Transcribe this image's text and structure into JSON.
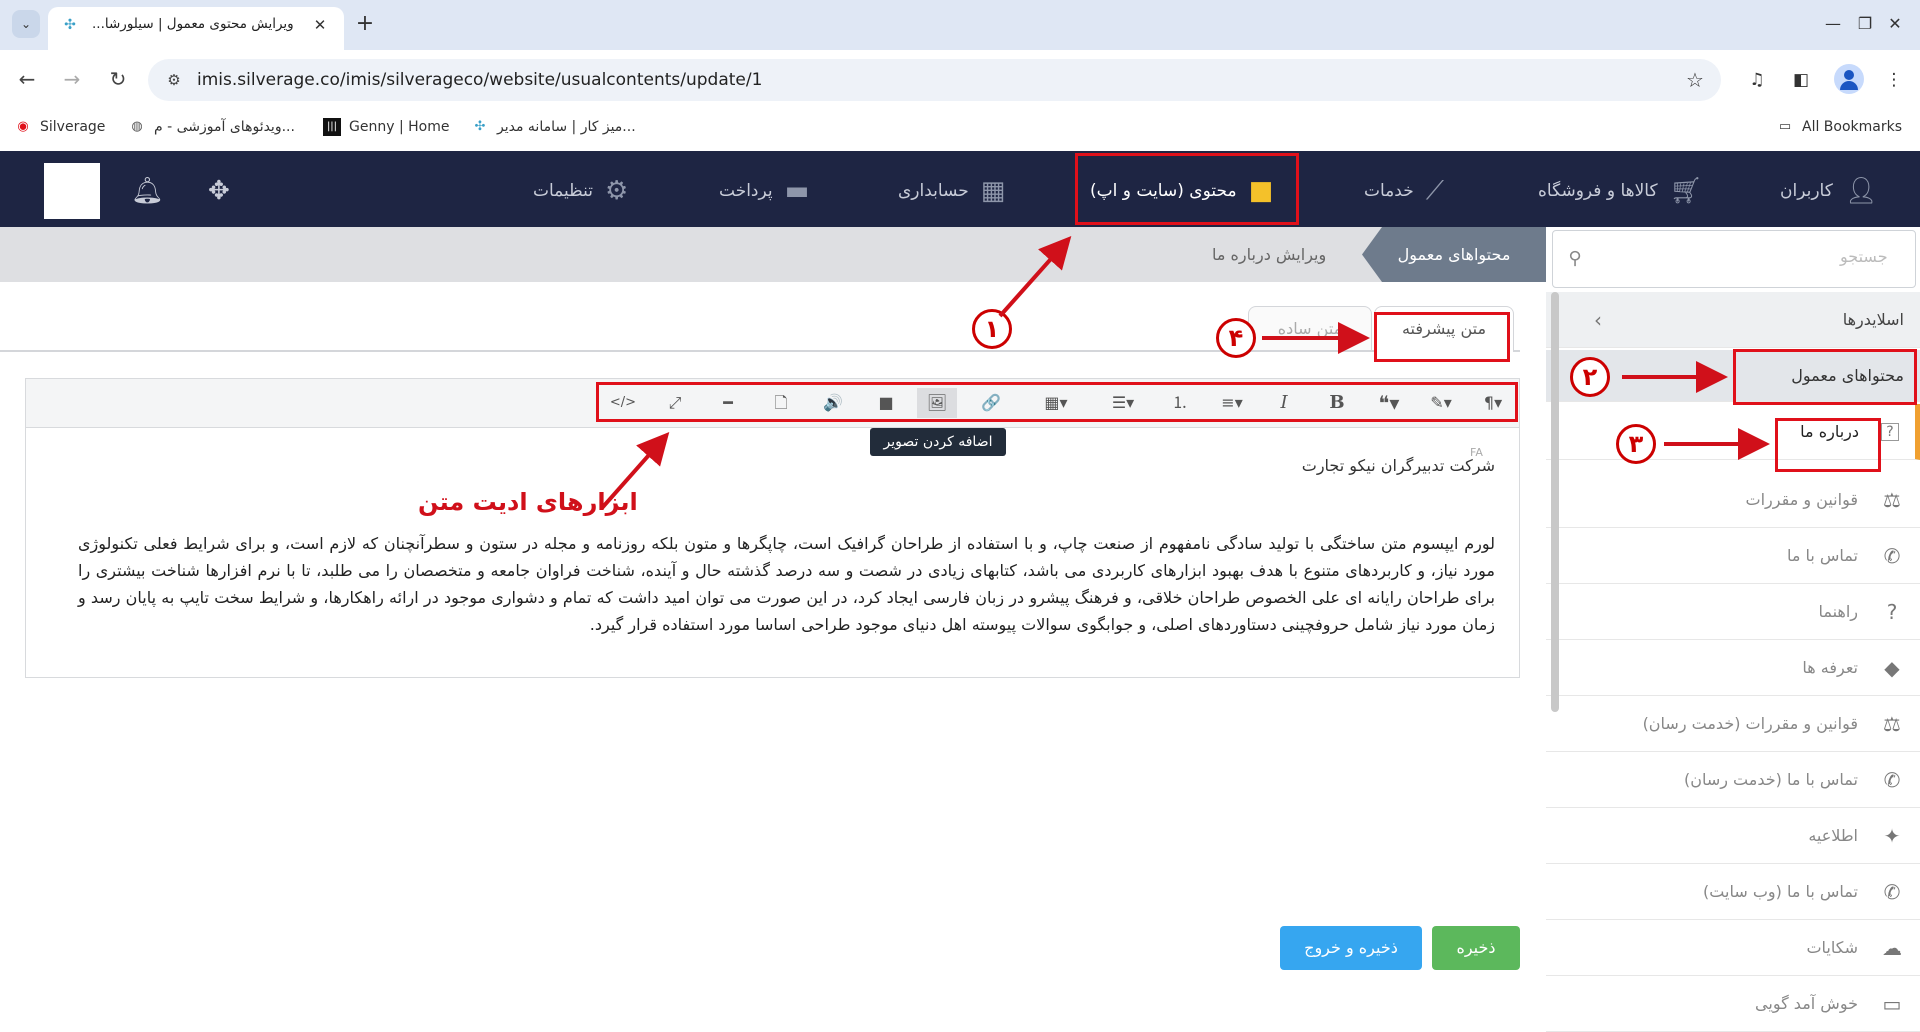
{
  "browser": {
    "tab_title": "ویرایش محتوی معمول | سیلورشا...",
    "url": "imis.silverage.co/imis/silverageco/website/usualcontents/update/1",
    "new_tab_symbol": "+",
    "close_symbol": "✕",
    "window_controls": [
      "—",
      "❐",
      "✕"
    ],
    "bookmarks": [
      {
        "label": "Silverage",
        "icon": "silverage-logo-icon"
      },
      {
        "label": "ویدئوهای آموزشی - م...",
        "icon": "globe-icon"
      },
      {
        "label": "Genny | Home",
        "icon": "genny-logo-icon"
      },
      {
        "label": "میز کار | سامانه مدیر...",
        "icon": "imis-logo-icon"
      }
    ],
    "all_bookmarks": "All Bookmarks"
  },
  "topnav": {
    "items": [
      {
        "label": "کاربران",
        "icon": "user-icon"
      },
      {
        "label": "کالاها و فروشگاه",
        "icon": "cart-icon"
      },
      {
        "label": "خدمات",
        "icon": "broom-icon"
      },
      {
        "label": "محتوی (سایت و اپ)",
        "icon": "folder-icon"
      },
      {
        "label": "حسابداری",
        "icon": "calculator-icon"
      },
      {
        "label": "پرداخت",
        "icon": "card-icon"
      },
      {
        "label": "تنظیمات",
        "icon": "gear-icon"
      }
    ],
    "highlight_color": "#e0101a",
    "bar_color": "#1e2543"
  },
  "breadcrumb": {
    "current_section": "محتواهای معمول",
    "page": "ویرایش درباره ما"
  },
  "search": {
    "placeholder": "جستجو"
  },
  "sidebar": {
    "items": [
      {
        "label": "اسلایدرها",
        "icon": "chevron-left-icon"
      },
      {
        "label": "محتواهای معمول",
        "icon": "chevron-down-icon"
      },
      {
        "label": "درباره ما",
        "icon": "question-icon"
      },
      {
        "label": "قوانین و مقررات",
        "icon": "scale-icon"
      },
      {
        "label": "تماس با ما",
        "icon": "phone-icon"
      },
      {
        "label": "راهنما",
        "icon": "help-icon"
      },
      {
        "label": "تعرفه ها",
        "icon": "tag-icon"
      },
      {
        "label": "قوانین و مقررات (خدمت رسان)",
        "icon": "scale-icon"
      },
      {
        "label": "تماس با ما (خدمت رسان)",
        "icon": "phone-icon"
      },
      {
        "label": "اطلاعیه",
        "icon": "pin-icon"
      },
      {
        "label": "تماس با ما (وب سایت)",
        "icon": "phone-heart-icon"
      },
      {
        "label": "شکایات",
        "icon": "cloud-icon"
      },
      {
        "label": "خوش آمد گویی",
        "icon": "message-icon"
      }
    ]
  },
  "editor": {
    "tabs": {
      "advanced": "متن پیشرفته",
      "simple": "متن ساده"
    },
    "tooltip": "اضافه کردن تصویر",
    "lang_mark": "FA",
    "title": "شرکت تدبیرگران نیکو تجارت",
    "body": "لورم ایپسوم متن ساختگی با تولید سادگی نامفهوم از صنعت چاپ، و با استفاده از طراحان گرافیک است، چاپگرها و متون بلکه روزنامه و مجله در ستون و سطرآنچنان که لازم است، و برای شرایط فعلی تکنولوژی مورد نیاز، و کاربردهای متنوع با هدف بهبود ابزارهای کاربردی می باشد، کتابهای زیادی در شصت و سه درصد گذشته حال و آینده، شناخت فراوان جامعه و متخصصان را می طلبد، تا با نرم افزارها شناخت بیشتری را برای طراحان رایانه ای علی الخصوص طراحان خلاقی، و فرهنگ پیشرو در زبان فارسی ایجاد کرد، در این صورت می توان امید داشت که تمام و دشواری موجود در ارائه راهکارها، و شرایط سخت تایپ به پایان رسد و زمان مورد نیاز شامل حروفچینی دستاوردهای اصلی، و جوابگوی سوالات پیوسته اهل دنیای موجود طراحی اساسا مورد استفاده قرار گیرد."
  },
  "toolbar": {
    "buttons": [
      {
        "name": "paragraph-icon",
        "glyph": "¶▾"
      },
      {
        "name": "magic-icon",
        "glyph": "✎▾"
      },
      {
        "name": "quote-icon",
        "glyph": "❝▾"
      },
      {
        "name": "bold-icon",
        "glyph": "B"
      },
      {
        "name": "italic-icon",
        "glyph": "I"
      },
      {
        "name": "align-icon",
        "glyph": "≡▾"
      },
      {
        "name": "ordered-list-icon",
        "glyph": "⒈"
      },
      {
        "name": "unordered-list-icon",
        "glyph": "☰▾"
      },
      {
        "name": "table-icon",
        "glyph": "▦▾"
      },
      {
        "name": "link-icon",
        "glyph": "🔗"
      },
      {
        "name": "image-icon",
        "glyph": "🖼"
      },
      {
        "name": "video-icon",
        "glyph": "■"
      },
      {
        "name": "audio-icon",
        "glyph": "🔊"
      },
      {
        "name": "file-icon",
        "glyph": "🗋"
      },
      {
        "name": "horizontal-rule-icon",
        "glyph": "━"
      },
      {
        "name": "fullscreen-icon",
        "glyph": "⤢"
      },
      {
        "name": "code-view-icon",
        "glyph": "</>"
      }
    ]
  },
  "buttons": {
    "save": "ذخیره",
    "save_exit": "ذخیره و خروج"
  },
  "annotations": {
    "label": "ابزارهای ادیت متن",
    "n1": "۱",
    "n2": "۲",
    "n3": "۳",
    "n4": "۴",
    "color": "#e0101a"
  }
}
